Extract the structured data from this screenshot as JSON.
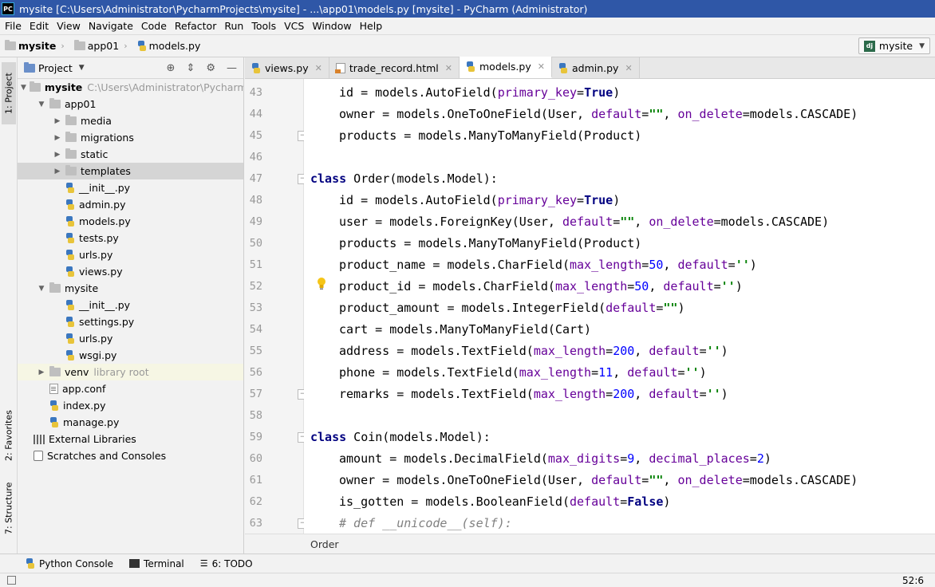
{
  "window": {
    "logo": "PC",
    "title": "mysite [C:\\Users\\Administrator\\PycharmProjects\\mysite] - ...\\app01\\models.py [mysite] - PyCharm (Administrator)"
  },
  "menu": [
    "File",
    "Edit",
    "View",
    "Navigate",
    "Code",
    "Refactor",
    "Run",
    "Tools",
    "VCS",
    "Window",
    "Help"
  ],
  "breadcrumb": [
    "mysite",
    "app01",
    "models.py"
  ],
  "run_config": {
    "logo": "dj",
    "label": "mysite"
  },
  "left_strip": {
    "project": "1: Project",
    "favorites": "2: Favorites",
    "structure": "7: Structure"
  },
  "project_panel": {
    "title": "Project",
    "tree": [
      {
        "label": "mysite",
        "hint": "C:\\Users\\Administrator\\PycharmProje",
        "bold": true,
        "depth": 0,
        "arrow": "▼",
        "icon": "folder-icon"
      },
      {
        "label": "app01",
        "depth": 1,
        "arrow": "▼",
        "icon": "folder-icon"
      },
      {
        "label": "media",
        "depth": 2,
        "arrow": "▶",
        "icon": "folder-icon"
      },
      {
        "label": "migrations",
        "depth": 2,
        "arrow": "▶",
        "icon": "folder-icon"
      },
      {
        "label": "static",
        "depth": 2,
        "arrow": "▶",
        "icon": "folder-icon"
      },
      {
        "label": "templates",
        "depth": 2,
        "arrow": "▶",
        "icon": "folder-icon",
        "selected": true
      },
      {
        "label": "__init__.py",
        "depth": 2,
        "icon": "python-file-icon"
      },
      {
        "label": "admin.py",
        "depth": 2,
        "icon": "python-file-icon"
      },
      {
        "label": "models.py",
        "depth": 2,
        "icon": "python-file-icon"
      },
      {
        "label": "tests.py",
        "depth": 2,
        "icon": "python-file-icon"
      },
      {
        "label": "urls.py",
        "depth": 2,
        "icon": "python-file-icon"
      },
      {
        "label": "views.py",
        "depth": 2,
        "icon": "python-file-icon"
      },
      {
        "label": "mysite",
        "depth": 1,
        "arrow": "▼",
        "icon": "folder-icon"
      },
      {
        "label": "__init__.py",
        "depth": 2,
        "icon": "python-file-icon"
      },
      {
        "label": "settings.py",
        "depth": 2,
        "icon": "python-file-icon"
      },
      {
        "label": "urls.py",
        "depth": 2,
        "icon": "python-file-icon"
      },
      {
        "label": "wsgi.py",
        "depth": 2,
        "icon": "python-file-icon"
      },
      {
        "label": "venv",
        "hint": "library root",
        "depth": 1,
        "arrow": "▶",
        "icon": "folder-icon",
        "highlight": true
      },
      {
        "label": "app.conf",
        "depth": 1,
        "icon": "text-file-icon"
      },
      {
        "label": "index.py",
        "depth": 1,
        "icon": "python-file-icon"
      },
      {
        "label": "manage.py",
        "depth": 1,
        "icon": "python-file-icon"
      },
      {
        "label": "External Libraries",
        "depth": 0,
        "icon": "libraries-icon"
      },
      {
        "label": "Scratches and Consoles",
        "depth": 0,
        "icon": "scratches-icon"
      }
    ]
  },
  "tabs": [
    {
      "label": "views.py",
      "icon": "python-file-icon",
      "active": false
    },
    {
      "label": "trade_record.html",
      "icon": "html-file-icon",
      "active": false
    },
    {
      "label": "models.py",
      "icon": "python-file-icon",
      "active": true
    },
    {
      "label": "admin.py",
      "icon": "python-file-icon",
      "active": false
    }
  ],
  "editor": {
    "current_line": 52,
    "lines": [
      {
        "n": 43,
        "indent": 1,
        "tokens": [
          [
            "id = models.AutoField(",
            ""
          ],
          [
            "primary_key",
            "kwarg"
          ],
          [
            "=",
            ""
          ],
          [
            "True",
            "kw"
          ],
          [
            ")",
            ""
          ]
        ]
      },
      {
        "n": 44,
        "indent": 1,
        "tokens": [
          [
            "owner = models.OneToOneField(User, ",
            ""
          ],
          [
            "default",
            "kwarg"
          ],
          [
            "=",
            ""
          ],
          [
            "\"\"",
            "str"
          ],
          [
            ", ",
            ""
          ],
          [
            "on_delete",
            "kwarg"
          ],
          [
            "=models.CASCADE)",
            ""
          ]
        ]
      },
      {
        "n": 45,
        "indent": 1,
        "fold": true,
        "tokens": [
          [
            "products = models.ManyToManyField(Product)",
            ""
          ]
        ]
      },
      {
        "n": 46,
        "indent": 0,
        "tokens": []
      },
      {
        "n": 47,
        "indent": 0,
        "fold": true,
        "tokens": [
          [
            "class",
            "kw"
          ],
          [
            " Order(models.Model):",
            ""
          ]
        ]
      },
      {
        "n": 48,
        "indent": 1,
        "tokens": [
          [
            "id = models.AutoField(",
            ""
          ],
          [
            "primary_key",
            "kwarg"
          ],
          [
            "=",
            ""
          ],
          [
            "True",
            "kw"
          ],
          [
            ")",
            ""
          ]
        ]
      },
      {
        "n": 49,
        "indent": 1,
        "tokens": [
          [
            "user = models.ForeignKey(User, ",
            ""
          ],
          [
            "default",
            "kwarg"
          ],
          [
            "=",
            ""
          ],
          [
            "\"\"",
            "str"
          ],
          [
            ", ",
            ""
          ],
          [
            "on_delete",
            "kwarg"
          ],
          [
            "=models.CASCADE)",
            ""
          ]
        ]
      },
      {
        "n": 50,
        "indent": 1,
        "tokens": [
          [
            "products = models.ManyToManyField(Product)",
            ""
          ]
        ]
      },
      {
        "n": 51,
        "indent": 1,
        "tokens": [
          [
            "product_name = models.CharField(",
            ""
          ],
          [
            "max_length",
            "kwarg"
          ],
          [
            "=",
            ""
          ],
          [
            "50",
            "num"
          ],
          [
            ", ",
            ""
          ],
          [
            "default",
            "kwarg"
          ],
          [
            "=",
            ""
          ],
          [
            "''",
            "str"
          ],
          [
            ")",
            ""
          ]
        ]
      },
      {
        "n": 52,
        "indent": 1,
        "tokens": [
          [
            "product_id = models.CharField(",
            ""
          ],
          [
            "max_length",
            "kwarg"
          ],
          [
            "=",
            ""
          ],
          [
            "50",
            "num"
          ],
          [
            ", ",
            ""
          ],
          [
            "default",
            "kwarg"
          ],
          [
            "=",
            ""
          ],
          [
            "''",
            "str"
          ],
          [
            ")",
            ""
          ]
        ]
      },
      {
        "n": 53,
        "indent": 1,
        "tokens": [
          [
            "product_amount = models.IntegerField(",
            ""
          ],
          [
            "default",
            "kwarg"
          ],
          [
            "=",
            ""
          ],
          [
            "\"\"",
            "str"
          ],
          [
            ")",
            ""
          ]
        ]
      },
      {
        "n": 54,
        "indent": 1,
        "tokens": [
          [
            "cart = models.ManyToManyField(Cart)",
            ""
          ]
        ]
      },
      {
        "n": 55,
        "indent": 1,
        "tokens": [
          [
            "address = models.TextField(",
            ""
          ],
          [
            "max_length",
            "kwarg"
          ],
          [
            "=",
            ""
          ],
          [
            "200",
            "num"
          ],
          [
            ", ",
            ""
          ],
          [
            "default",
            "kwarg"
          ],
          [
            "=",
            ""
          ],
          [
            "''",
            "str"
          ],
          [
            ")",
            ""
          ]
        ]
      },
      {
        "n": 56,
        "indent": 1,
        "tokens": [
          [
            "phone = models.TextField(",
            ""
          ],
          [
            "max_length",
            "kwarg"
          ],
          [
            "=",
            ""
          ],
          [
            "11",
            "num"
          ],
          [
            ", ",
            ""
          ],
          [
            "default",
            "kwarg"
          ],
          [
            "=",
            ""
          ],
          [
            "''",
            "str"
          ],
          [
            ")",
            ""
          ]
        ]
      },
      {
        "n": 57,
        "indent": 1,
        "fold": true,
        "tokens": [
          [
            "remarks = models.TextField(",
            ""
          ],
          [
            "max_length",
            "kwarg"
          ],
          [
            "=",
            ""
          ],
          [
            "200",
            "num"
          ],
          [
            ", ",
            ""
          ],
          [
            "default",
            "kwarg"
          ],
          [
            "=",
            ""
          ],
          [
            "''",
            "str"
          ],
          [
            ")",
            ""
          ]
        ]
      },
      {
        "n": 58,
        "indent": 0,
        "tokens": []
      },
      {
        "n": 59,
        "indent": 0,
        "fold": true,
        "tokens": [
          [
            "class",
            "kw"
          ],
          [
            " Coin(models.Model):",
            ""
          ]
        ]
      },
      {
        "n": 60,
        "indent": 1,
        "tokens": [
          [
            "amount = models.DecimalField(",
            ""
          ],
          [
            "max_digits",
            "kwarg"
          ],
          [
            "=",
            ""
          ],
          [
            "9",
            "num"
          ],
          [
            ", ",
            ""
          ],
          [
            "decimal_places",
            "kwarg"
          ],
          [
            "=",
            ""
          ],
          [
            "2",
            "num"
          ],
          [
            ")",
            ""
          ]
        ]
      },
      {
        "n": 61,
        "indent": 1,
        "tokens": [
          [
            "owner = models.OneToOneField(User, ",
            ""
          ],
          [
            "default",
            "kwarg"
          ],
          [
            "=",
            ""
          ],
          [
            "\"\"",
            "str"
          ],
          [
            ", ",
            ""
          ],
          [
            "on_delete",
            "kwarg"
          ],
          [
            "=models.CASCADE)",
            ""
          ]
        ]
      },
      {
        "n": 62,
        "indent": 1,
        "tokens": [
          [
            "is_gotten = models.BooleanField(",
            ""
          ],
          [
            "default",
            "kwarg"
          ],
          [
            "=",
            ""
          ],
          [
            "False",
            "kw"
          ],
          [
            ")",
            ""
          ]
        ]
      },
      {
        "n": 63,
        "indent": 1,
        "fold": true,
        "tokens": [
          [
            "# def __unicode__(self):",
            "cmt"
          ]
        ]
      }
    ]
  },
  "editor_breadcrumb": "Order",
  "bottom_tools": [
    {
      "label": "Python Console",
      "icon": "python-console-icon"
    },
    {
      "label": "Terminal",
      "icon": "terminal-icon"
    },
    {
      "label": "6: TODO",
      "icon": "todo-icon"
    }
  ],
  "status": {
    "position": "52:6"
  }
}
